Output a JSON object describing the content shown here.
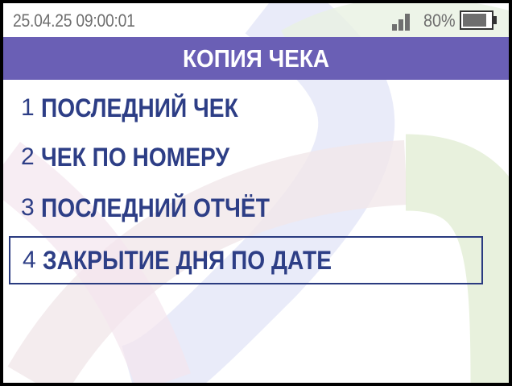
{
  "status": {
    "datetime": "25.04.25 09:00:01",
    "battery_percent": "80%",
    "battery_level": 0.85,
    "signal_bars": 3
  },
  "header": {
    "title": "КОПИЯ ЧЕКА"
  },
  "menu": {
    "items": [
      {
        "number": "1",
        "label": "ПОСЛЕДНИЙ ЧЕК",
        "selected": false
      },
      {
        "number": "2",
        "label": "ЧЕК ПО НОМЕРУ",
        "selected": false
      },
      {
        "number": "3",
        "label": "ПОСЛЕДНИЙ ОТЧЁТ",
        "selected": false
      },
      {
        "number": "4",
        "label": "ЗАКРЫТИЕ ДНЯ ПО ДАТЕ",
        "selected": true
      }
    ]
  },
  "colors": {
    "title_bar": "#6a5fb5",
    "menu_text": "#2d3e86",
    "status_text": "#6e6e6e"
  }
}
